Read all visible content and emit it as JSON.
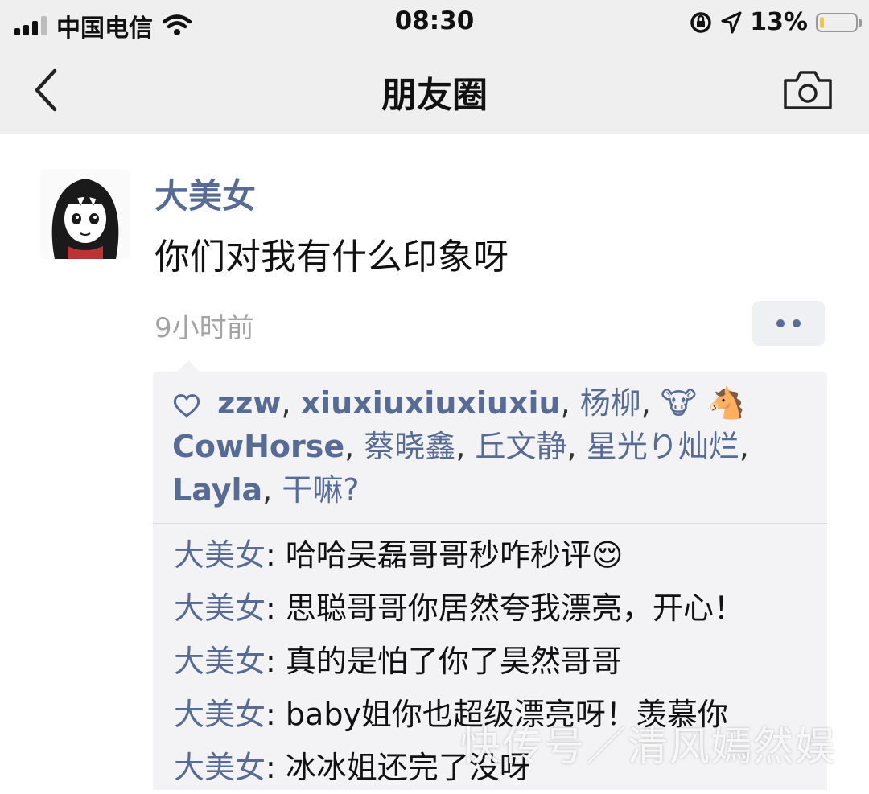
{
  "status_bar": {
    "carrier": "中国电信",
    "time": "08:30",
    "battery_percent": "13%",
    "battery_level": 0.13,
    "icons": [
      "signal-icon",
      "wifi-icon",
      "rotation-lock-icon",
      "location-icon",
      "battery-icon"
    ]
  },
  "nav": {
    "title": "朋友圈",
    "back_icon": "chevron-left-icon",
    "camera_icon": "camera-icon"
  },
  "post": {
    "author": "大美女",
    "text": "你们对我有什么印象呀",
    "time": "9小时前",
    "more_icon": "more-dots-icon"
  },
  "likes": {
    "icon": "heart-outline-icon",
    "names": [
      "zzw",
      "xiuxiuxiuxiuxiu",
      "杨柳",
      "🐮 🐴 CowHorse",
      "蔡晓鑫",
      "丘文静",
      "星光り灿烂",
      "Layla",
      "干嘛?"
    ]
  },
  "comments": [
    {
      "author": "大美女",
      "colon": ": ",
      "text": "哈哈吴磊哥哥秒咋秒评😌"
    },
    {
      "author": "大美女",
      "colon": ": ",
      "text": "思聪哥哥你居然夸我漂亮，开心！"
    },
    {
      "author": "大美女",
      "colon": ": ",
      "text": "真的是怕了你了昊然哥哥"
    },
    {
      "author": "大美女",
      "colon": ": ",
      "text": "baby姐你也超级漂亮呀！羡慕你"
    },
    {
      "author": "大美女",
      "colon": ": ",
      "text": "冰冰姐还完了没呀"
    }
  ],
  "watermark": "快传号／清风嫣然娱"
}
